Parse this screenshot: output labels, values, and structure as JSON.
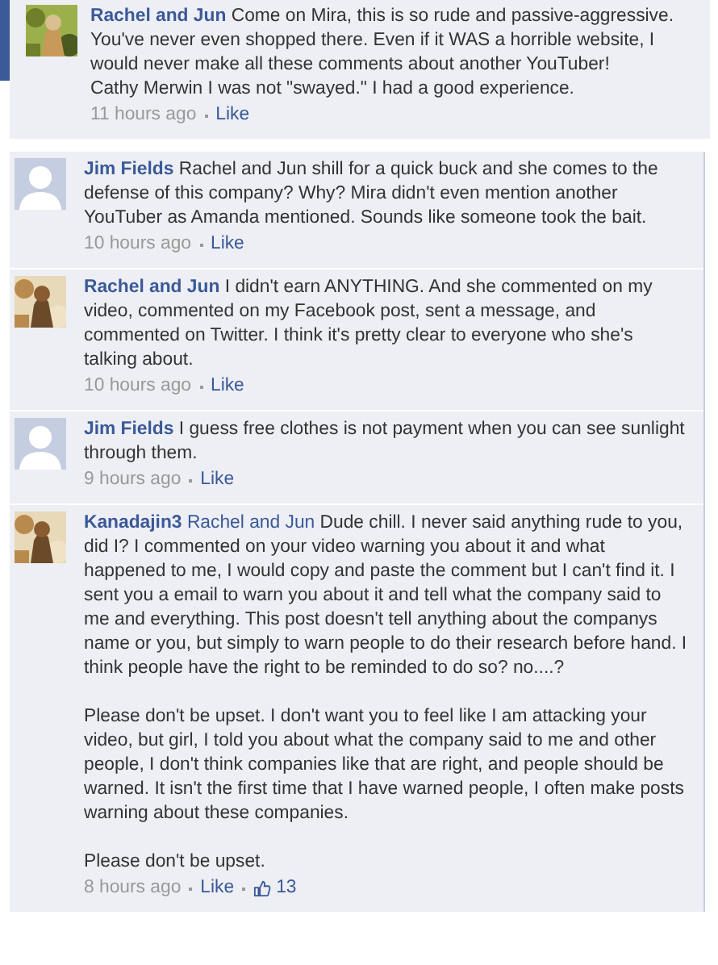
{
  "top_comment": {
    "author": "Rachel and Jun",
    "text": "Come on Mira, this is so rude and passive-aggressive. You've never even shopped there. Even if it WAS a horrible website, I would never make all these comments about another YouTuber!\nCathy Merwin I was not \"swayed.\" I had a good experience.",
    "time": "11 hours ago",
    "like": "Like"
  },
  "comments": [
    {
      "author": "Jim Fields",
      "avatar": {
        "kind": "default"
      },
      "text": "Rachel and Jun shill for a quick buck and she comes to the defense of this company? Why? Mira didn't even mention another YouTuber as Amanda mentioned. Sounds like someone took the bait.",
      "time": "10 hours ago",
      "like": "Like"
    },
    {
      "author": "Rachel and Jun",
      "text": "I didn't earn ANYTHING. And she commented on my video, commented on my Facebook post, sent a message, and commented on Twitter. I think it's pretty clear to everyone who she's talking about.",
      "time": "10 hours ago",
      "like": "Like"
    },
    {
      "author": "Jim Fields",
      "avatar": {
        "kind": "default"
      },
      "text": "I guess free clothes is not payment when you can see sunlight through them.",
      "time": "9 hours ago",
      "like": "Like"
    },
    {
      "author": "Kanadajin3",
      "mention": "Rachel and Jun",
      "text": "Dude chill. I never said anything rude to you, did I? I commented on your video warning you about it and what happened to me, I would copy and paste the comment but I can't find it. I sent you a email to warn you about it and tell what the company said to me and everything. This post doesn't tell anything about the companys name or you, but simply to warn people to do their research before hand. I think people have the right to be reminded to do so? no....?\n\nPlease don't be upset. I don't want you to feel like I am attacking your video, but girl, I told you about what the company said to me and other people, I don't think companies like that are right, and people should be warned. It isn't the first time that I have warned people, I often make posts warning about these companies.\n\nPlease don't be upset.",
      "time": "8 hours ago",
      "like": "Like",
      "like_count": "13"
    }
  ]
}
